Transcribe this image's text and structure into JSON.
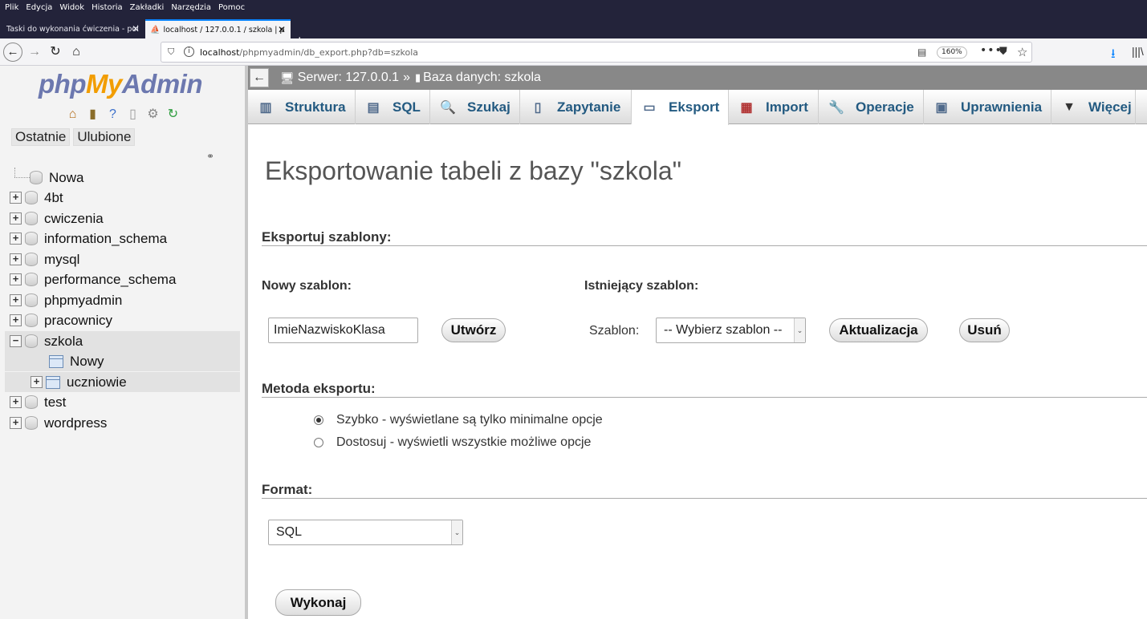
{
  "browser": {
    "menu": [
      "Plik",
      "Edycja",
      "Widok",
      "Historia",
      "Zakładki",
      "Narzędzia",
      "Pomoc"
    ],
    "tabs": [
      {
        "label": "Taski do wykonania ćwiczenia - pol"
      },
      {
        "label": "localhost / 127.0.0.1 / szkola | p"
      }
    ],
    "url_host": "localhost",
    "url_path": "/phpmyadmin/db_export.php?db=szkola",
    "zoom": "160%"
  },
  "navigation": {
    "logo": {
      "php": "php",
      "my": "My",
      "admin": "Admin"
    },
    "recent_label": "Ostatnie",
    "favorites_label": "Ulubione",
    "tree": [
      {
        "label": "Nowa"
      },
      {
        "label": "4bt"
      },
      {
        "label": "cwiczenia"
      },
      {
        "label": "information_schema"
      },
      {
        "label": "mysql"
      },
      {
        "label": "performance_schema"
      },
      {
        "label": "phpmyadmin"
      },
      {
        "label": "pracownicy"
      },
      {
        "label": "szkola"
      },
      {
        "label": "Nowy"
      },
      {
        "label": "uczniowie"
      },
      {
        "label": "test"
      },
      {
        "label": "wordpress"
      }
    ]
  },
  "breadcrumb": {
    "server": "Serwer: 127.0.0.1",
    "separator": "»",
    "database": "Baza danych: szkola"
  },
  "tabs": [
    {
      "label": "Struktura",
      "icon": "structure-icon"
    },
    {
      "label": "SQL",
      "icon": "sql-icon"
    },
    {
      "label": "Szukaj",
      "icon": "search-icon"
    },
    {
      "label": "Zapytanie",
      "icon": "query-icon"
    },
    {
      "label": "Eksport",
      "icon": "export-icon"
    },
    {
      "label": "Import",
      "icon": "import-icon"
    },
    {
      "label": "Operacje",
      "icon": "wrench-icon"
    },
    {
      "label": "Uprawnienia",
      "icon": "privileges-icon"
    },
    {
      "label": "Więcej",
      "icon": "chevron-down-icon"
    }
  ],
  "page": {
    "title": "Eksportowanie tabeli z bazy \"szkola\"",
    "templates_heading": "Eksportuj szablony:",
    "new_template_label": "Nowy szablon:",
    "new_template_value": "ImieNazwiskoKlasa",
    "create_button": "Utwórz",
    "existing_template_label": "Istniejący szablon:",
    "template_select_label": "Szablon:",
    "template_select_value": "-- Wybierz szablon --",
    "update_button": "Aktualizacja",
    "delete_button": "Usuń",
    "method_heading": "Metoda eksportu:",
    "method_quick": "Szybko - wyświetlane są tylko minimalne opcje",
    "method_custom": "Dostosuj - wyświetli wszystkie możliwe opcje",
    "format_heading": "Format:",
    "format_value": "SQL",
    "execute_button": "Wykonaj"
  }
}
